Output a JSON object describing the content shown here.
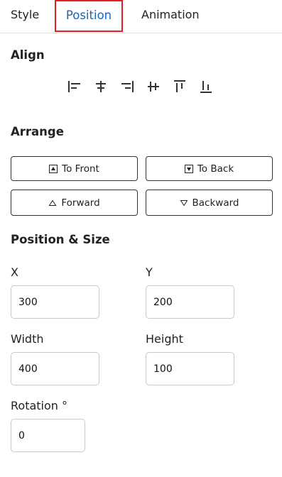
{
  "tabs": [
    {
      "label": "Style"
    },
    {
      "label": "Position"
    },
    {
      "label": "Animation"
    }
  ],
  "align": {
    "title": "Align",
    "icons": [
      "align-left-icon",
      "align-center-horizontal-icon",
      "align-right-icon",
      "align-middle-icon",
      "align-top-icon",
      "align-bottom-icon"
    ]
  },
  "arrange": {
    "title": "Arrange",
    "to_front": "To Front",
    "to_back": "To Back",
    "forward": "Forward",
    "backward": "Backward"
  },
  "position_size": {
    "title": "Position & Size",
    "x_label": "X",
    "x_value": "300",
    "y_label": "Y",
    "y_value": "200",
    "width_label": "Width",
    "width_value": "400",
    "height_label": "Height",
    "height_value": "100",
    "rotation_label": "Rotation °",
    "rotation_value": "0"
  },
  "colors": {
    "active_tab": "#1a64b4",
    "highlight_border": "#e02020"
  }
}
